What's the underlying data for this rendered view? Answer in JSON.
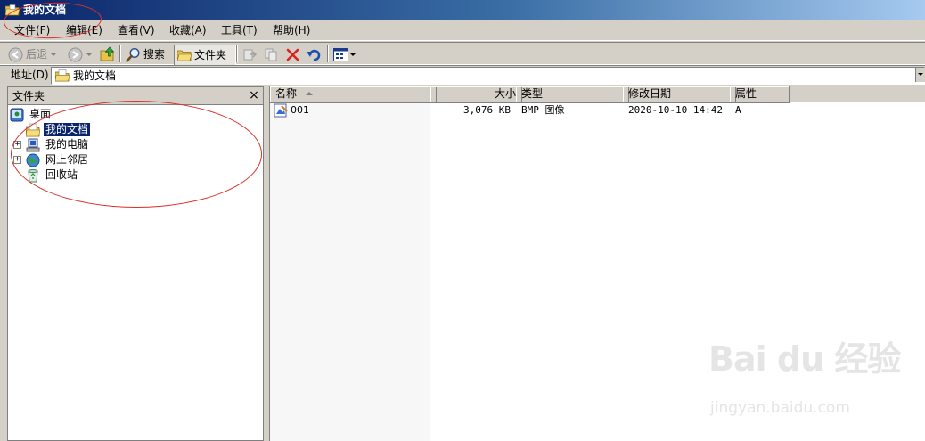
{
  "window": {
    "title": "我的文档"
  },
  "menu": [
    {
      "label": "文件(F)"
    },
    {
      "label": "编辑(E)"
    },
    {
      "label": "查看(V)"
    },
    {
      "label": "收藏(A)"
    },
    {
      "label": "工具(T)"
    },
    {
      "label": "帮助(H)"
    }
  ],
  "toolbar": {
    "back_label": "后退",
    "search_label": "搜索",
    "folders_label": "文件夹"
  },
  "address": {
    "label": "地址(D)",
    "value": "我的文档"
  },
  "folder_pane": {
    "title": "文件夹",
    "close_glyph": "×",
    "tree": [
      {
        "label": "桌面"
      },
      {
        "label": "我的文档",
        "selected": true
      },
      {
        "label": "我的电脑",
        "expander": "+"
      },
      {
        "label": "网上邻居",
        "expander": "+"
      },
      {
        "label": "回收站"
      }
    ]
  },
  "list": {
    "columns": [
      {
        "label": "名称"
      },
      {
        "label": "大小"
      },
      {
        "label": "类型"
      },
      {
        "label": "修改日期"
      },
      {
        "label": "属性"
      }
    ],
    "rows": [
      {
        "name": "001",
        "size": "3,076 KB",
        "type": "BMP 图像",
        "modified": "2020-10-10 14:42",
        "attributes": "A"
      }
    ]
  },
  "watermark": {
    "logo": "Bai du 经验",
    "url": "jingyan.baidu.com"
  },
  "colors": {
    "title_bar": "#0a246a",
    "selection": "#0a246a",
    "annotation": "#d9302a",
    "chrome": "#d4d0c8"
  }
}
